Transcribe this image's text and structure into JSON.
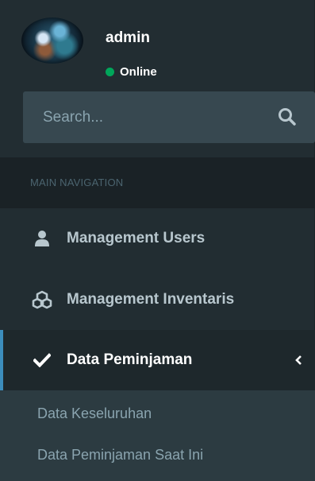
{
  "user": {
    "name": "admin",
    "status": "Online"
  },
  "search": {
    "placeholder": "Search..."
  },
  "nav": {
    "header": "MAIN NAVIGATION",
    "items": [
      {
        "label": "Management Users",
        "icon": "user-icon"
      },
      {
        "label": "Management Inventaris",
        "icon": "cubes-icon"
      },
      {
        "label": "Data Peminjaman",
        "icon": "check-icon",
        "active": true
      }
    ],
    "submenu": [
      {
        "label": "Data Keseluruhan"
      },
      {
        "label": "Data Peminjaman Saat Ini"
      }
    ]
  },
  "colors": {
    "sidebar_bg": "#222d32",
    "header_bg": "#1a2226",
    "active_bg": "#1e282c",
    "active_border": "#3c8dbc",
    "submenu_bg": "#2c3b41",
    "online": "#00a65a"
  }
}
